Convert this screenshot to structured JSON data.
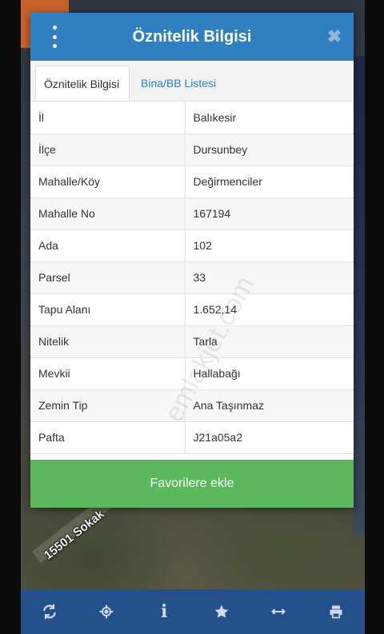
{
  "header": {
    "title": "Öznitelik Bilgisi",
    "close_symbol": "✖"
  },
  "tabs": [
    {
      "label": "Öznitelik Bilgisi",
      "active": true
    },
    {
      "label": "Bina/BB Listesi",
      "active": false
    }
  ],
  "attributes": [
    {
      "key": "İl",
      "value": "Balıkesir"
    },
    {
      "key": "İlçe",
      "value": "Dursunbey"
    },
    {
      "key": "Mahalle/Köy",
      "value": "Değirmenciler"
    },
    {
      "key": "Mahalle No",
      "value": "167194"
    },
    {
      "key": "Ada",
      "value": "102"
    },
    {
      "key": "Parsel",
      "value": "33"
    },
    {
      "key": "Tapu Alanı",
      "value": "1.652,14"
    },
    {
      "key": "Nitelik",
      "value": "Tarla"
    },
    {
      "key": "Mevkii",
      "value": "Hallabağı"
    },
    {
      "key": "Zemin Tip",
      "value": "Ana Taşınmaz"
    },
    {
      "key": "Pafta",
      "value": "J21a05a2"
    }
  ],
  "favorite_button": "Favorilere ekle",
  "map": {
    "road_label": "15501 Sokak"
  },
  "watermark": "emlakjet.com",
  "toolbar": {
    "info_symbol": "i",
    "icons": [
      "refresh-icon",
      "locate-icon",
      "info-icon",
      "star-icon",
      "measure-icon",
      "print-icon"
    ]
  },
  "colors": {
    "header": "#2f7fc1",
    "favorite_button": "#5cb85c",
    "toolbar": "#24508c"
  }
}
